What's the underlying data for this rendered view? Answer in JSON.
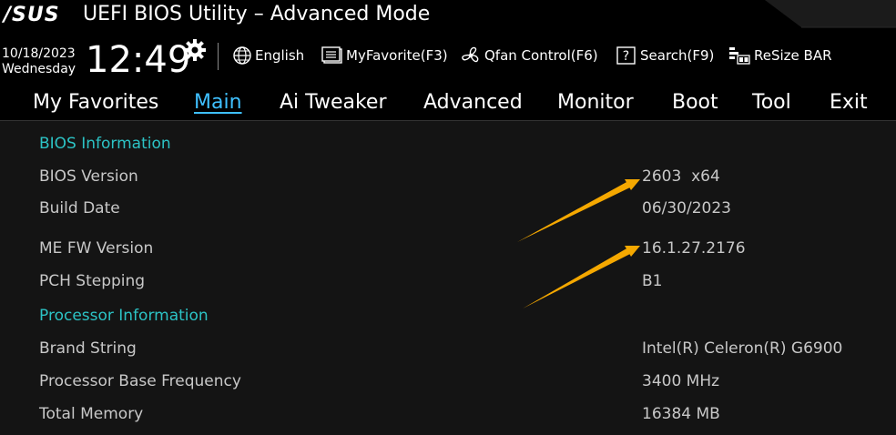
{
  "header": {
    "logo": "/SUS",
    "title": "UEFI BIOS Utility – Advanced Mode",
    "date": "10/18/2023",
    "weekday": "Wednesday",
    "time": "12:49",
    "tools": [
      {
        "icon": "globe-icon",
        "label": "English"
      },
      {
        "icon": "favorites-list-icon",
        "label": "MyFavorite(F3)"
      },
      {
        "icon": "fan-icon",
        "label": "Qfan Control(F6)"
      },
      {
        "icon": "question-box-icon",
        "label": "Search(F9)"
      },
      {
        "icon": "resize-bar-icon",
        "label": "ReSize BAR"
      }
    ]
  },
  "tabs": [
    {
      "label": "My Favorites",
      "active": false
    },
    {
      "label": "Main",
      "active": true
    },
    {
      "label": "Ai Tweaker",
      "active": false
    },
    {
      "label": "Advanced",
      "active": false
    },
    {
      "label": "Monitor",
      "active": false
    },
    {
      "label": "Boot",
      "active": false
    },
    {
      "label": "Tool",
      "active": false
    },
    {
      "label": "Exit",
      "active": false
    }
  ],
  "main": {
    "bios_section": "BIOS Information",
    "bios_rows": [
      {
        "label": "BIOS Version",
        "value": "2603  x64"
      },
      {
        "label": "Build Date",
        "value": "06/30/2023"
      },
      {
        "label": "ME FW Version",
        "value": "16.1.27.2176"
      },
      {
        "label": "PCH Stepping",
        "value": "B1"
      }
    ],
    "processor_section": "Processor Information",
    "processor_rows": [
      {
        "label": "Brand String",
        "value": "Intel(R) Celeron(R) G6900"
      },
      {
        "label": "Processor Base Frequency",
        "value": "3400 MHz"
      },
      {
        "label": "Total Memory",
        "value": "16384 MB"
      }
    ]
  },
  "colors": {
    "active_tab": "#3fc0ff",
    "section_title": "#2cc3c5",
    "annotation_arrow": "#f5a800"
  }
}
